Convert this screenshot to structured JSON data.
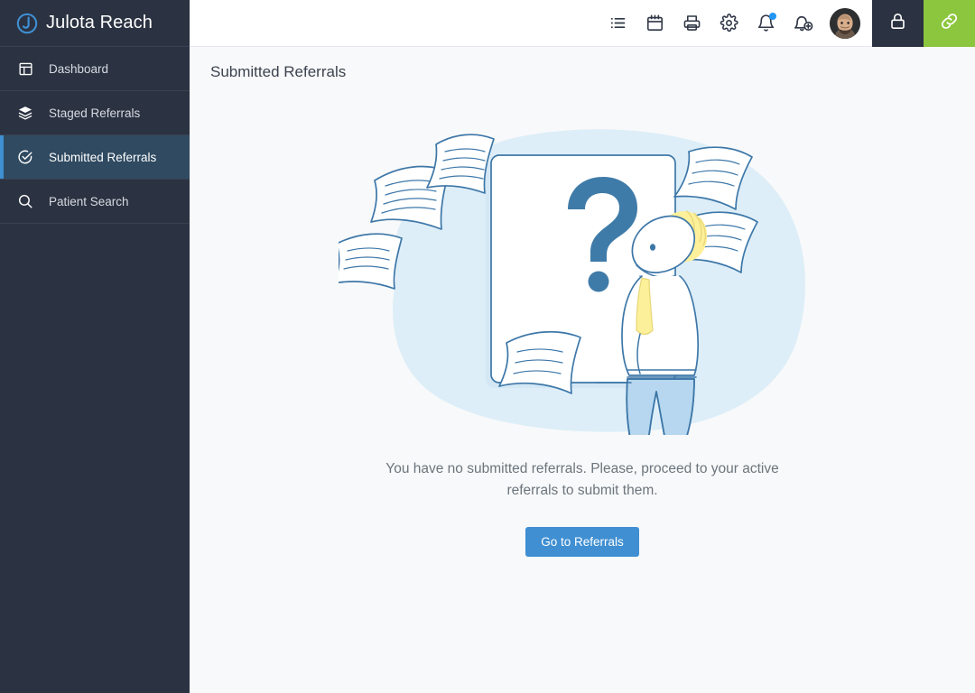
{
  "brand": {
    "name": "Julota Reach",
    "logo_icon": "julota-circle-j-logo",
    "logo_color": "#3f8fd2"
  },
  "sidebar": {
    "background_color": "#2b3241",
    "active_background_color": "#2f4a61",
    "active_accent_color": "#3f8fd2",
    "items": [
      {
        "label": "Dashboard",
        "icon": "dashboard-layout-icon",
        "active": false
      },
      {
        "label": "Staged Referrals",
        "icon": "layers-stack-icon",
        "active": false
      },
      {
        "label": "Submitted Referrals",
        "icon": "check-circle-icon",
        "active": true
      },
      {
        "label": "Patient Search",
        "icon": "search-magnifier-icon",
        "active": false
      }
    ]
  },
  "topbar": {
    "icons": [
      {
        "name": "list-icon",
        "badge": false
      },
      {
        "name": "calendar-icon",
        "badge": false
      },
      {
        "name": "printer-icon",
        "badge": false
      },
      {
        "name": "gear-icon",
        "badge": false
      },
      {
        "name": "bell-icon",
        "badge": true
      },
      {
        "name": "bell-add-icon",
        "badge": false
      }
    ],
    "notification_badge_color": "#2196f3",
    "avatar": {
      "name": "user-avatar",
      "alt": "User profile photo"
    },
    "lock_button": {
      "icon": "lock-icon",
      "background_color": "#2b3241"
    },
    "link_button": {
      "icon": "link-chain-icon",
      "background_color": "#8cc63e"
    }
  },
  "page": {
    "title": "Submitted Referrals",
    "background_color": "#f8f9fa"
  },
  "empty_state": {
    "illustration": "person-looking-at-document-with-question-mark",
    "message": "You have no submitted referrals. Please, proceed to your active referrals to submit them.",
    "cta_label": "Go to Referrals",
    "cta_color": "#3f8fd2",
    "illustration_colors": {
      "blob": "#ddeef8",
      "outline": "#3d77a8",
      "question_mark": "#3f7ba8",
      "hair": "#fdf09a",
      "pants": "#b6d7ef"
    }
  }
}
